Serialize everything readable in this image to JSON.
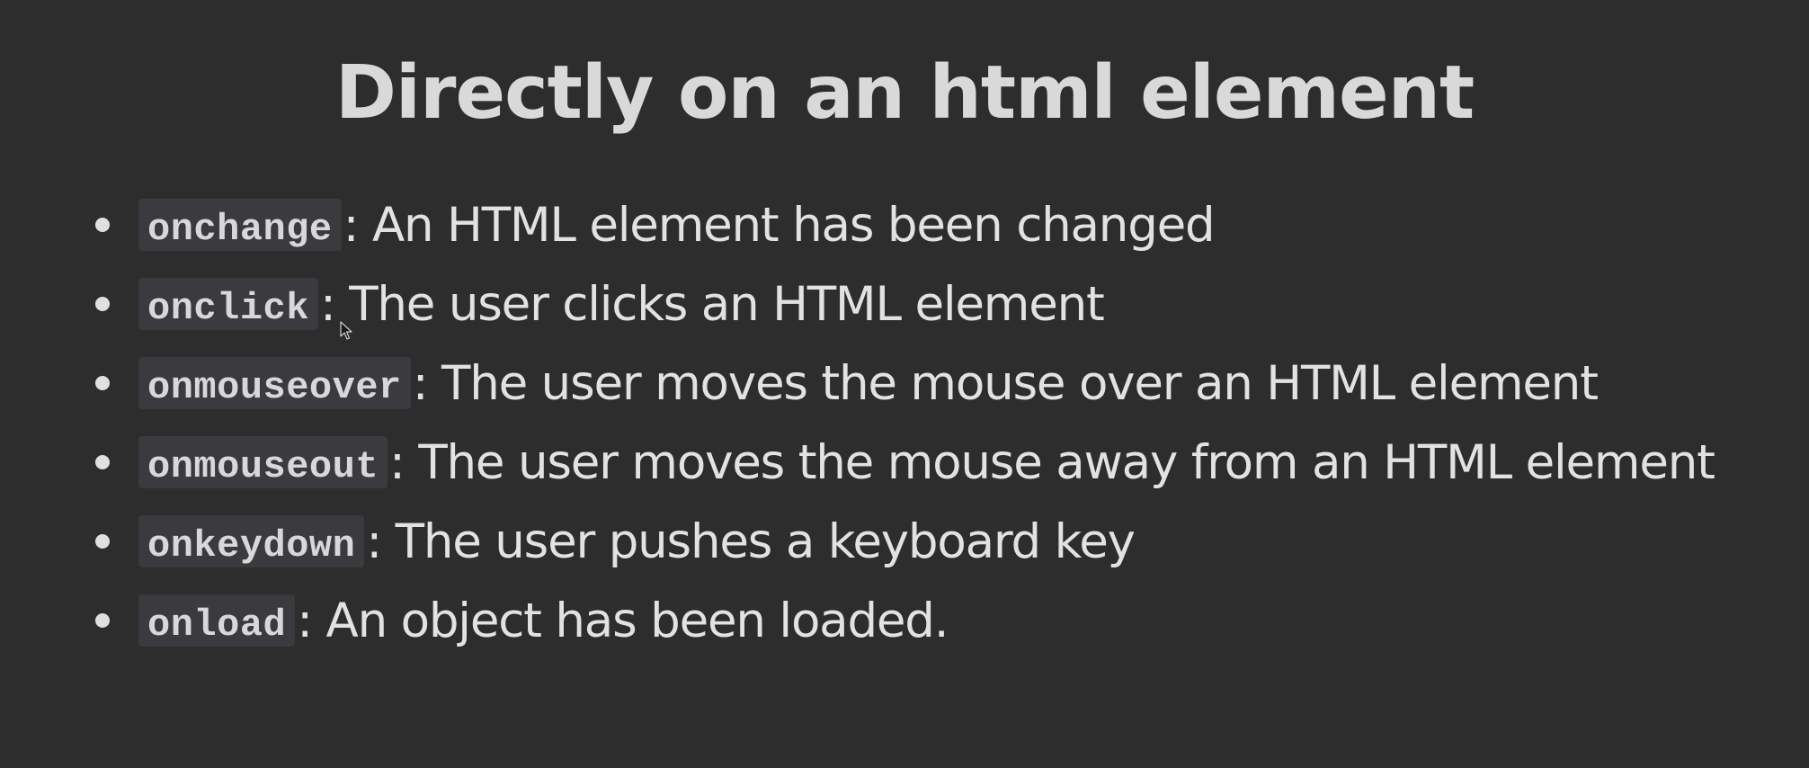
{
  "slide": {
    "title": "Directly on an html element",
    "events": [
      {
        "code": "onchange",
        "description": ": An HTML element has been changed"
      },
      {
        "code": "onclick",
        "description": ": The user clicks an HTML element"
      },
      {
        "code": "onmouseover",
        "description": ": The user moves the mouse over an HTML element"
      },
      {
        "code": "onmouseout",
        "description": ": The user moves the mouse away from an HTML element"
      },
      {
        "code": "onkeydown",
        "description": ": The user pushes a keyboard key"
      },
      {
        "code": "onload",
        "description": ": An object has been loaded."
      }
    ]
  },
  "colors": {
    "background": "#2d2d2d",
    "text": "#e2e2e2",
    "code_background": "#3b3b3f"
  },
  "icons": {
    "cursor": "mouse-pointer-icon"
  }
}
